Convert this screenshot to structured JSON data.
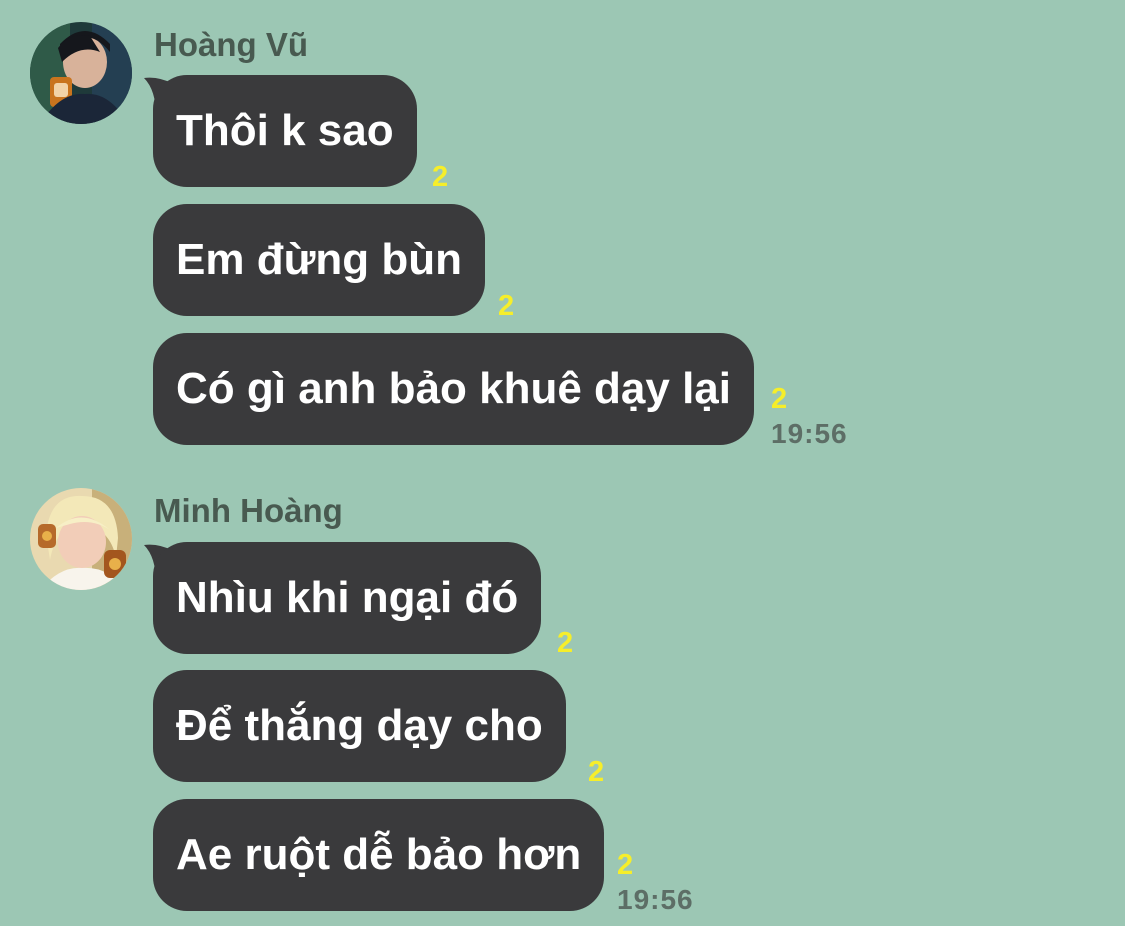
{
  "colors": {
    "background": "#9cc7b4",
    "bubble": "#3a3a3c",
    "bubble_text": "#ffffff",
    "read_count": "#f6ee2a",
    "sender_name": "#485a50",
    "timestamp": "#5d6e66"
  },
  "groups": [
    {
      "sender": "Hoàng Vũ",
      "avatar_icon": "user-avatar-photo",
      "messages": [
        {
          "text": "Thôi k sao",
          "read_count": "2"
        },
        {
          "text": "Em đừng bùn",
          "read_count": "2"
        },
        {
          "text": "Có gì anh bảo khuê dạy lại",
          "read_count": "2"
        }
      ],
      "time": "19:56"
    },
    {
      "sender": "Minh Hoàng",
      "avatar_icon": "user-avatar-photo",
      "messages": [
        {
          "text": "Nhìu khi ngại đó",
          "read_count": "2"
        },
        {
          "text": "Để thắng dạy cho",
          "read_count": "2"
        },
        {
          "text": "Ae ruột dễ bảo hơn",
          "read_count": "2"
        }
      ],
      "time": "19:56"
    }
  ]
}
